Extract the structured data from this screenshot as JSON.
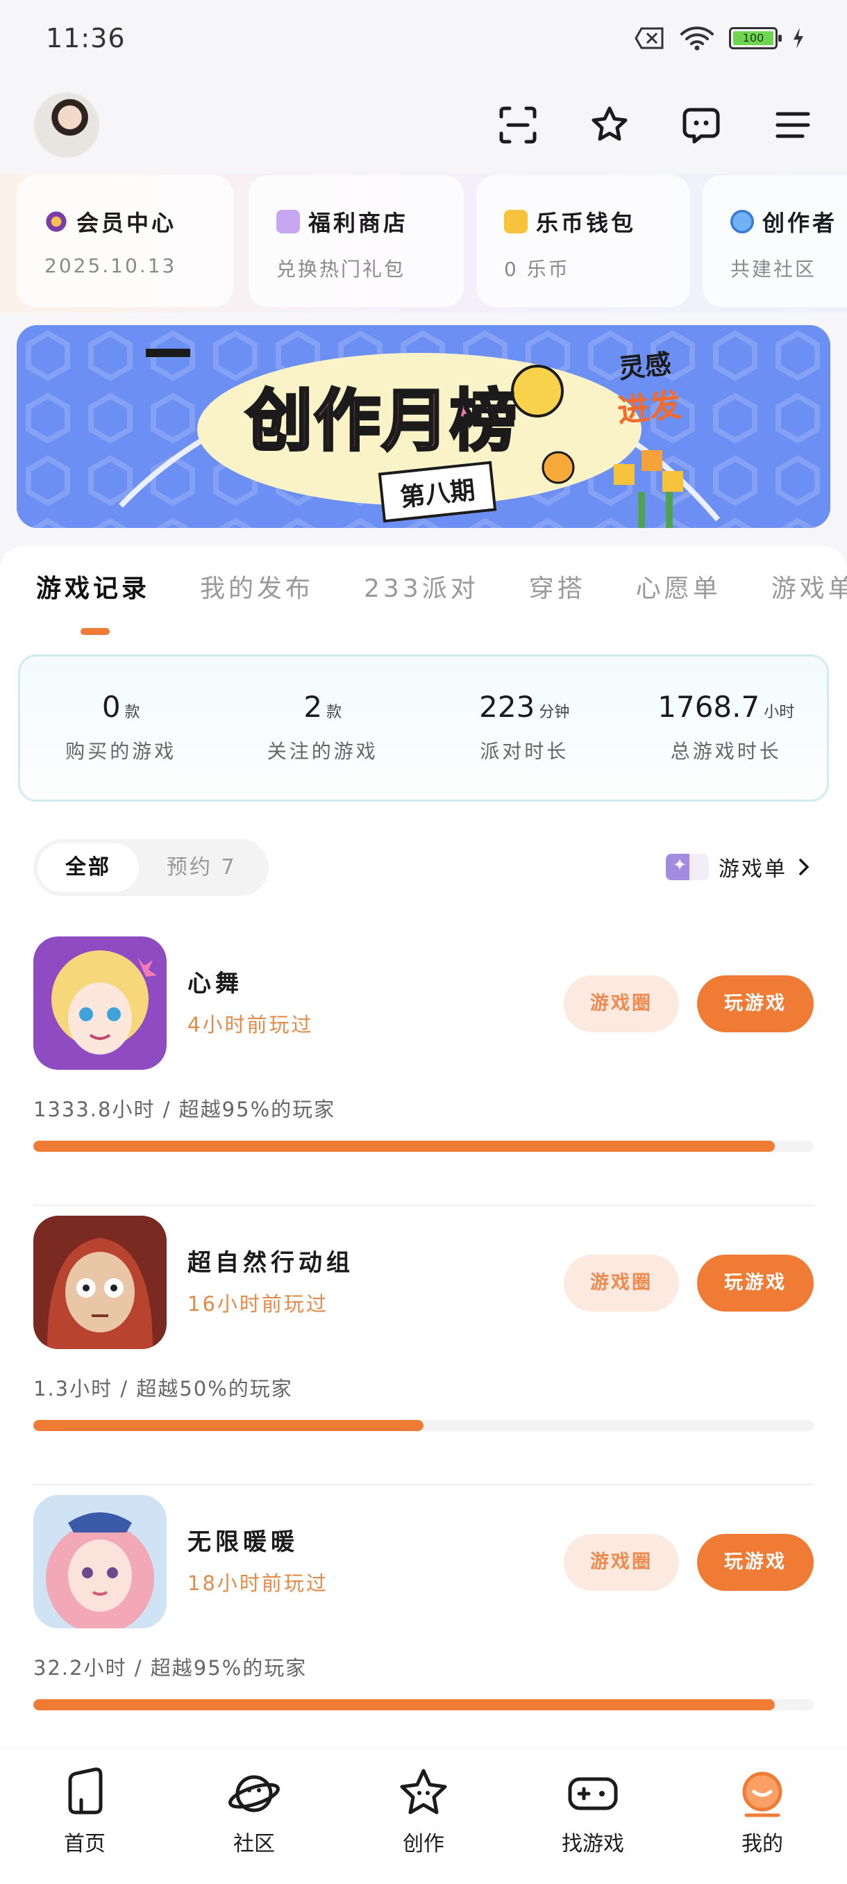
{
  "status_bar": {
    "time": "11:36",
    "battery": "100"
  },
  "quick_cards": [
    {
      "title": "会员中心",
      "sub": "2025.10.13",
      "icon": "vip-icon"
    },
    {
      "title": "福利商店",
      "sub": "兑换热门礼包",
      "icon": "gift-icon"
    },
    {
      "title": "乐币钱包",
      "sub": "0 乐币",
      "icon": "wallet-icon"
    },
    {
      "title": "创作者",
      "sub": "共建社区",
      "icon": "planet-icon"
    }
  ],
  "banner": {
    "title": "创作月榜",
    "sub": "第八期",
    "tag_top": "灵感",
    "tag_bottom": "进发"
  },
  "tabs": [
    "游戏记录",
    "我的发布",
    "233派对",
    "穿搭",
    "心愿单",
    "游戏单"
  ],
  "stats": [
    {
      "value": "0",
      "unit": "款",
      "label": "购买的游戏"
    },
    {
      "value": "2",
      "unit": "款",
      "label": "关注的游戏"
    },
    {
      "value": "223",
      "unit": "分钟",
      "label": "派对时长"
    },
    {
      "value": "1768.7",
      "unit": "小时",
      "label": "总游戏时长"
    }
  ],
  "filter": {
    "all": "全部",
    "reserved": "预约 7"
  },
  "game_list_link": "游戏单",
  "games": [
    {
      "name": "心舞",
      "last_played": "4小时前玩过",
      "stat": "1333.8小时 / 超越95%的玩家",
      "progress": 0.95,
      "btn_circle": "游戏圈",
      "btn_play": "玩游戏"
    },
    {
      "name": "超自然行动组",
      "last_played": "16小时前玩过",
      "stat": "1.3小时 / 超越50%的玩家",
      "progress": 0.5,
      "btn_circle": "游戏圈",
      "btn_play": "玩游戏"
    },
    {
      "name": "无限暖暖",
      "last_played": "18小时前玩过",
      "stat": "32.2小时 / 超越95%的玩家",
      "progress": 0.95,
      "btn_circle": "游戏圈",
      "btn_play": "玩游戏"
    }
  ],
  "nav": [
    "首页",
    "社区",
    "创作",
    "找游戏",
    "我的"
  ],
  "colors": {
    "accent": "#f07b35",
    "accent_light": "#fce9df",
    "banner_blue": "#6b8ff2"
  }
}
